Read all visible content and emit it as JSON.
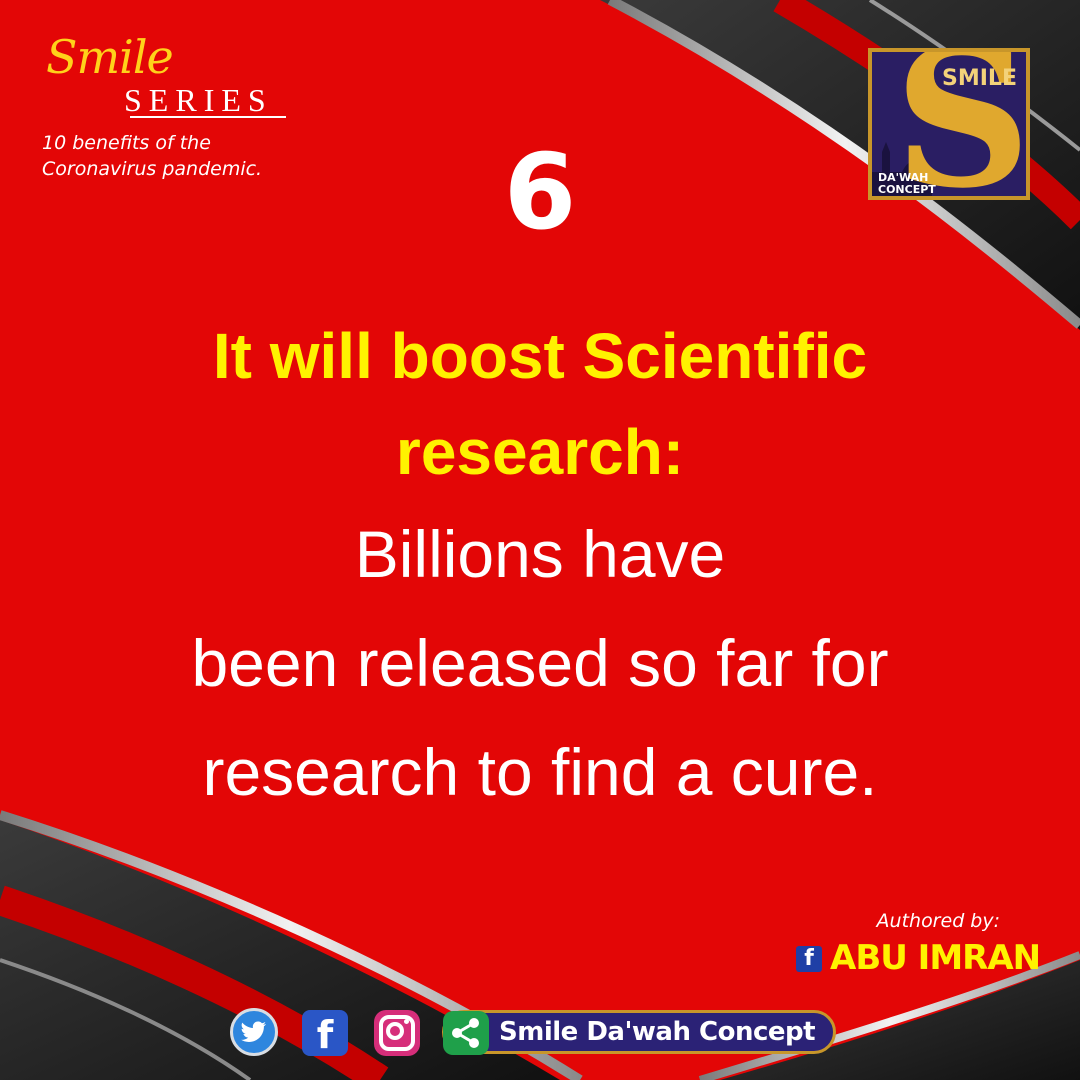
{
  "brand": {
    "script": "Smile",
    "series": "SERIES",
    "subtitle_lines": [
      "10 benefits of the",
      "Coronavirus pandemic."
    ]
  },
  "logo": {
    "letter": "S",
    "word": "SMILE",
    "sub_lines": [
      "DA'WAH",
      "CONCEPT"
    ]
  },
  "item_number": "6",
  "headline_lines": [
    "It will boost Scientific",
    "research:"
  ],
  "body_lines": [
    "Billions have",
    "been released so far for",
    "research to find a cure."
  ],
  "author": {
    "label": "Authored by:",
    "name": "ABU IMRAN"
  },
  "social": {
    "facebook_glyph": "f",
    "handle": "Smile Da'wah Concept"
  },
  "colors": {
    "background": "#e80404",
    "headline": "#fff200",
    "body": "#ffffff",
    "gold": "#c8962a",
    "navy": "#2b2276"
  }
}
